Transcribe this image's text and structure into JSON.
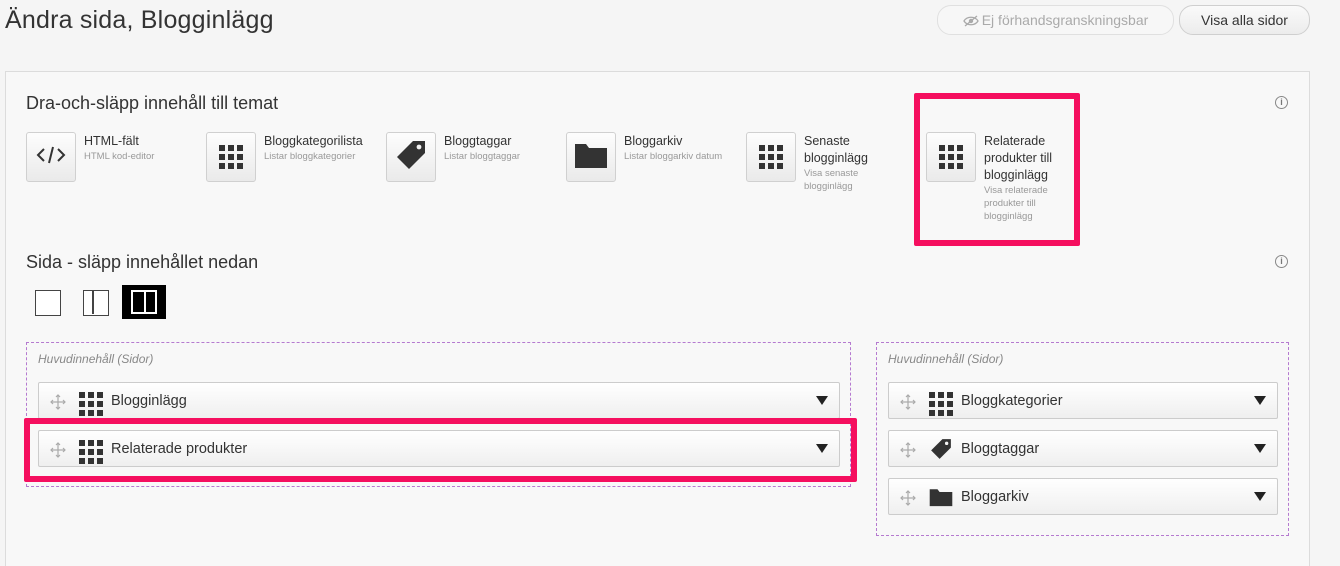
{
  "header": {
    "title": "Ändra sida, Blogginlägg",
    "preview_label": "Ej förhandsgranskningsbar",
    "show_all_label": "Visa alla sidor"
  },
  "dragdrop": {
    "title": "Dra-och-släpp innehåll till temat",
    "widgets": [
      {
        "title": "HTML-fält",
        "desc": "HTML kod-editor",
        "icon": "code-icon"
      },
      {
        "title": "Bloggkategorilista",
        "desc": "Listar bloggkategorier",
        "icon": "grid-icon"
      },
      {
        "title": "Bloggtaggar",
        "desc": "Listar bloggtaggar",
        "icon": "tag-icon"
      },
      {
        "title": "Bloggarkiv",
        "desc": "Listar bloggarkiv datum",
        "icon": "folder-icon"
      },
      {
        "title": "Senaste blogginlägg",
        "desc": "Visa senaste blogginlägg",
        "icon": "grid-icon"
      },
      {
        "title": "Relaterade produkter till blogginlägg",
        "desc": "Visa relaterade produkter till blogginlägg",
        "icon": "grid-icon"
      }
    ]
  },
  "page_section": {
    "title": "Sida - släpp innehållet nedan",
    "layouts": [
      "single-column",
      "two-column",
      "two-column-wide"
    ],
    "active_layout": "two-column-wide"
  },
  "zones": [
    {
      "label": "Huvudinnehåll (Sidor)",
      "blocks": [
        {
          "label": "Blogginlägg",
          "icon": "grid-icon"
        },
        {
          "label": "Relaterade produkter",
          "icon": "grid-icon"
        }
      ]
    },
    {
      "label": "Huvudinnehåll (Sidor)",
      "blocks": [
        {
          "label": "Bloggkategorier",
          "icon": "grid-icon"
        },
        {
          "label": "Bloggtaggar",
          "icon": "tag-icon"
        },
        {
          "label": "Bloggarkiv",
          "icon": "folder-icon"
        }
      ]
    }
  ],
  "colors": {
    "highlight": "#f50f5f",
    "dropzone_border": "#b57ad0",
    "active_layout": "#000000"
  }
}
